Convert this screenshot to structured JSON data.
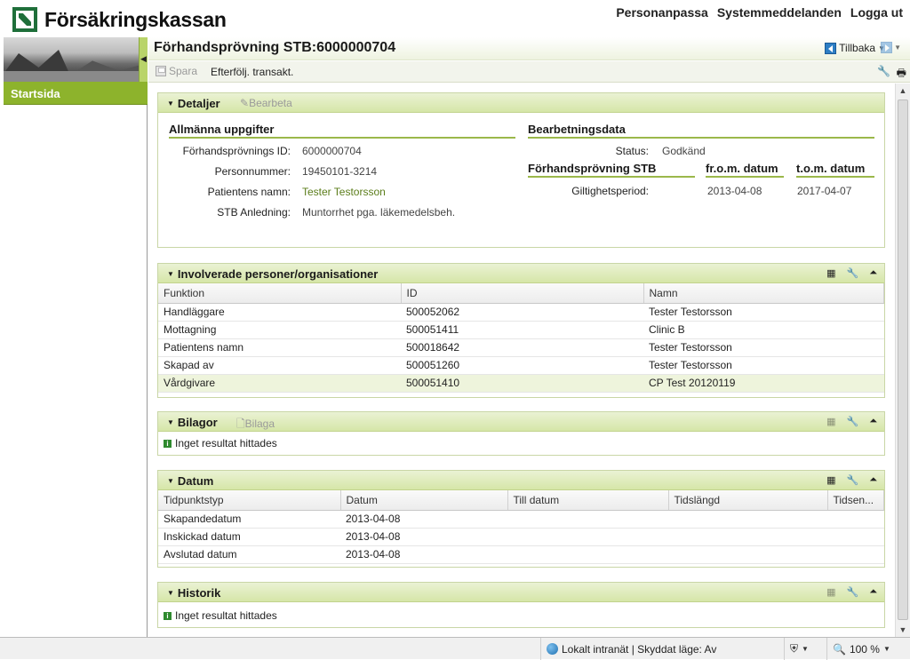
{
  "header": {
    "logo_text": "Försäkringskassan",
    "links": [
      "Personanpassa",
      "Systemmeddelanden",
      "Logga ut"
    ]
  },
  "sidebar": {
    "items": [
      {
        "label": "Startsida"
      }
    ]
  },
  "page": {
    "title": "Förhandsprövning STB:6000000704",
    "back_label": "Tillbaka"
  },
  "toolbar": {
    "save_label": "Spara",
    "followup_label": "Efterfölj. transakt."
  },
  "details": {
    "title": "Detaljer",
    "edit_label": "Bearbeta",
    "general_header": "Allmänna uppgifter",
    "processing_header": "Bearbetningsdata",
    "fields": [
      {
        "label": "Förhandsprövnings ID:",
        "value": "6000000704"
      },
      {
        "label": "Personnummer:",
        "value": "19450101-3214"
      },
      {
        "label": "Patientens namn:",
        "value": "Tester Testorsson"
      },
      {
        "label": "STB Anledning:",
        "value": "Muntorrhet pga. läkemedelsbeh."
      }
    ],
    "status_label": "Status:",
    "status_value": "Godkänd",
    "stb_header": "Förhandsprövning STB",
    "from_header": "fr.o.m. datum",
    "to_header": "t.o.m. datum",
    "validity_label": "Giltighetsperiod:",
    "from_value": "2013-04-08",
    "to_value": "2017-04-07"
  },
  "involved": {
    "title": "Involverade personer/organisationer",
    "columns": [
      "Funktion",
      "ID",
      "Namn"
    ],
    "rows": [
      [
        "Handläggare",
        "500052062",
        "Tester Testorsson"
      ],
      [
        "Mottagning",
        "500051411",
        "Clinic B"
      ],
      [
        "Patientens namn",
        "500018642",
        "Tester Testorsson"
      ],
      [
        "Skapad av",
        "500051260",
        "Tester Testorsson"
      ],
      [
        "Vårdgivare",
        "500051410",
        "CP Test 20120119"
      ]
    ]
  },
  "attachments": {
    "title": "Bilagor",
    "add_label": "Bilaga",
    "empty_text": "Inget resultat hittades"
  },
  "dates": {
    "title": "Datum",
    "columns": [
      "Tidpunktstyp",
      "Datum",
      "Till datum",
      "Tidslängd",
      "Tidsen..."
    ],
    "rows": [
      [
        "Skapandedatum",
        "2013-04-08",
        "",
        "",
        ""
      ],
      [
        "Inskickad datum",
        "2013-04-08",
        "",
        "",
        ""
      ],
      [
        "Avslutad datum",
        "2013-04-08",
        "",
        "",
        ""
      ]
    ]
  },
  "history": {
    "title": "Historik",
    "empty_text": "Inget resultat hittades"
  },
  "statusbar": {
    "zone": "Lokalt intranät | Skyddat läge: Av",
    "zoom": "100 %"
  },
  "colors": {
    "accent": "#8db32c",
    "panel_header": "#d6e6a8",
    "link_green": "#5b7d1a"
  }
}
